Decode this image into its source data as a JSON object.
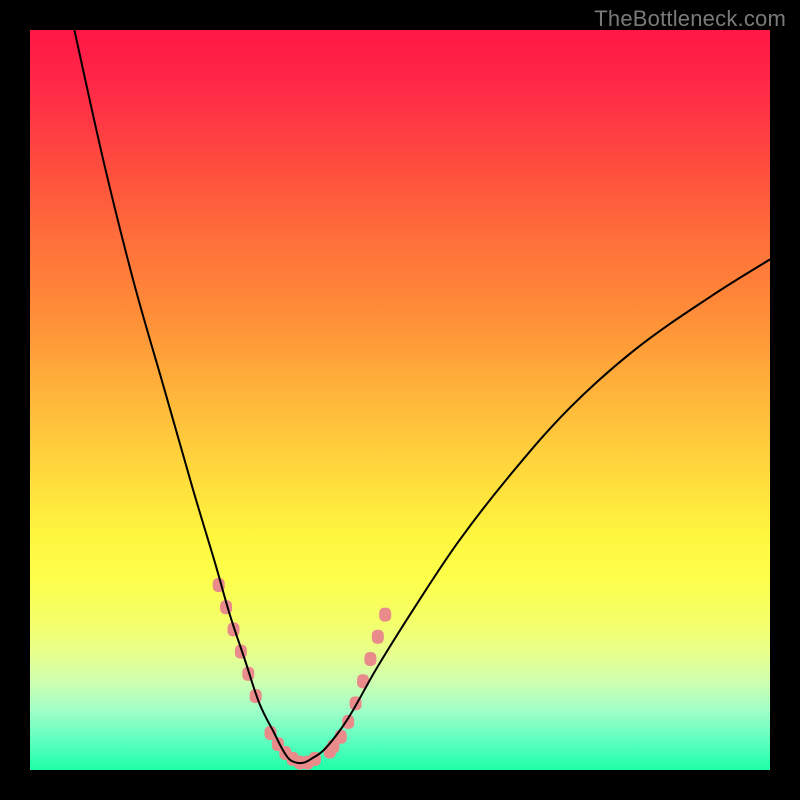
{
  "watermark": "TheBottleneck.com",
  "chart_data": {
    "type": "line",
    "title": "",
    "xlabel": "",
    "ylabel": "",
    "xlim": [
      0,
      100
    ],
    "ylim": [
      0,
      100
    ],
    "grid": false,
    "legend": false,
    "series": [
      {
        "name": "bottleneck-curve",
        "color": "#000000",
        "x": [
          6,
          10,
          14,
          18,
          22,
          25,
          27,
          29,
          31,
          33,
          34,
          35,
          36,
          37,
          38,
          40,
          43,
          47,
          52,
          58,
          65,
          73,
          82,
          92,
          100
        ],
        "y": [
          100,
          82,
          66,
          52,
          38,
          28,
          21,
          15,
          9,
          5,
          3,
          1.5,
          1,
          1,
          1.5,
          3,
          7,
          14,
          22,
          31,
          40,
          49,
          57,
          64,
          69
        ]
      },
      {
        "name": "highlight-dots",
        "color": "#e98b8b",
        "type": "scatter",
        "x": [
          25.5,
          26.5,
          27.5,
          28.5,
          29.5,
          30.5,
          32.5,
          33.5,
          34.5,
          35.5,
          36.5,
          37.5,
          38.5,
          40.5,
          41.0,
          42.0,
          43.0,
          44.0,
          45.0,
          46.0,
          47.0,
          48.0
        ],
        "y": [
          25,
          22,
          19,
          16,
          13,
          10,
          5,
          3.5,
          2.3,
          1.5,
          1,
          1,
          1.5,
          2.5,
          3.2,
          4.5,
          6.5,
          9,
          12,
          15,
          18,
          21
        ]
      }
    ]
  }
}
